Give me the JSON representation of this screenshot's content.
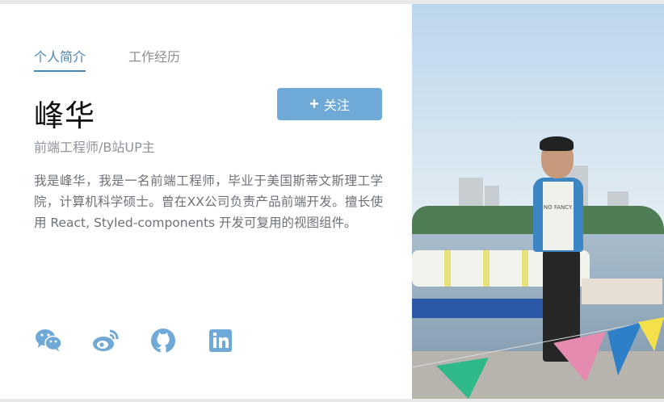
{
  "tabs": [
    {
      "label": "个人简介",
      "active": true
    },
    {
      "label": "工作经历",
      "active": false
    }
  ],
  "profile": {
    "name": "峰华",
    "title": "前端工程师/B站UP主",
    "bio": "我是峰华，我是一名前端工程师，毕业于美国斯蒂文斯理工学院，计算机科学硕士。曾在XX公司负责产品前端开发。擅长使用 React, Styled-components 开发可复用的视图组件。"
  },
  "follow_button": {
    "label": "关注",
    "icon": "plus-icon"
  },
  "socials": [
    {
      "name": "wechat-icon"
    },
    {
      "name": "weibo-icon"
    },
    {
      "name": "github-icon"
    },
    {
      "name": "linkedin-icon"
    }
  ],
  "photo": {
    "shirt_text": "NO FANCY."
  },
  "colors": {
    "accent": "#4a86b5",
    "button": "#6fa9d8",
    "icon": "#6fa9d8",
    "text_muted": "#8e949b",
    "text_body": "#6b7178"
  }
}
